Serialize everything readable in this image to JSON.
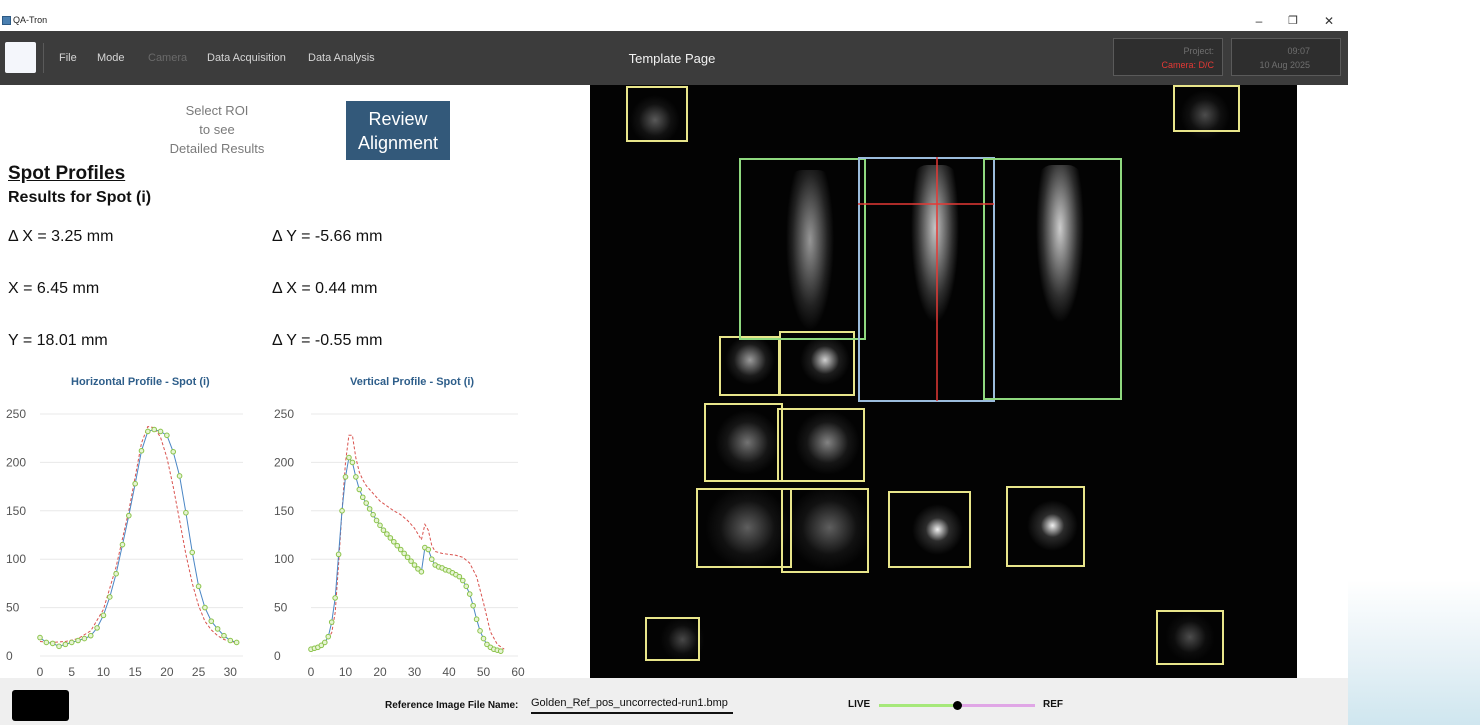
{
  "window": {
    "title": "QA-Tron",
    "minimize_symbol": "–",
    "restore_symbol": "❐",
    "close_symbol": "✕"
  },
  "header": {
    "menu": [
      "File",
      "Mode",
      "Camera",
      "Data Acquisition",
      "Data Analysis"
    ],
    "disabled_menu": [
      "Camera"
    ],
    "page_title": "Template Page",
    "project_label": "Project:",
    "camera_status": "Camera: D/C",
    "time": "09:07",
    "date": "10 Aug 2025"
  },
  "left_panel": {
    "select_roi_lines": [
      "Select ROI",
      "to see",
      "Detailed Results"
    ],
    "review_button_lines": [
      "Review",
      "Alignment"
    ],
    "section_title": "Spot Profiles",
    "section_subtitle": "Results for Spot (i)",
    "measurements": [
      "Δ X = 3.25 mm",
      "Δ Y = -5.66 mm",
      "X = 6.45 mm",
      "Δ X = 0.44 mm",
      "Y = 18.01 mm",
      "Δ Y = -0.55 mm"
    ]
  },
  "chart_data": [
    {
      "type": "line",
      "title": "Horizontal Profile - Spot (i)",
      "xlim": [
        0,
        32
      ],
      "ylim": [
        0,
        250
      ],
      "xticks": [
        0,
        5,
        10,
        15,
        20,
        25,
        30
      ],
      "yticks": [
        0,
        50,
        100,
        150,
        200,
        250
      ],
      "grid": true,
      "series": [
        {
          "style": "markers",
          "color": "#8bc34a",
          "x": [
            0,
            1,
            2,
            3,
            4,
            5,
            6,
            7,
            8,
            9,
            10,
            11,
            12,
            13,
            14,
            15,
            16,
            17,
            18,
            19,
            20,
            21,
            22,
            23,
            24,
            25,
            26,
            27,
            28,
            29,
            30,
            31
          ],
          "y": [
            19,
            14,
            13,
            10,
            12,
            14,
            16,
            18,
            21,
            29,
            42,
            61,
            85,
            115,
            145,
            178,
            212,
            232,
            234,
            232,
            228,
            211,
            186,
            148,
            107,
            72,
            50,
            36,
            28,
            21,
            16,
            14
          ]
        },
        {
          "style": "solid",
          "color": "#4a86c5",
          "x": [
            0,
            1,
            2,
            3,
            4,
            5,
            6,
            7,
            8,
            9,
            10,
            11,
            12,
            13,
            14,
            15,
            16,
            17,
            18,
            19,
            20,
            21,
            22,
            23,
            24,
            25,
            26,
            27,
            28,
            29,
            30,
            31
          ],
          "y": [
            19,
            14,
            13,
            10,
            12,
            14,
            16,
            18,
            21,
            29,
            42,
            61,
            85,
            115,
            145,
            178,
            212,
            232,
            234,
            232,
            228,
            211,
            186,
            148,
            107,
            72,
            50,
            36,
            28,
            21,
            16,
            14
          ]
        },
        {
          "style": "dashed",
          "color": "#d9534f",
          "x": [
            0,
            2,
            4,
            6,
            8,
            10,
            12,
            14,
            15,
            16,
            17,
            18,
            19,
            20,
            21,
            22,
            23,
            24,
            25,
            26,
            27,
            28,
            29,
            30,
            31
          ],
          "y": [
            15,
            14,
            15,
            18,
            26,
            48,
            92,
            150,
            185,
            220,
            237,
            236,
            226,
            205,
            175,
            140,
            105,
            75,
            52,
            36,
            27,
            21,
            17,
            15,
            14
          ]
        }
      ]
    },
    {
      "type": "line",
      "title": "Vertical Profile - Spot (i)",
      "xlim": [
        0,
        60
      ],
      "ylim": [
        0,
        250
      ],
      "xticks": [
        0,
        10,
        20,
        30,
        40,
        50,
        60
      ],
      "yticks": [
        0,
        50,
        100,
        150,
        200,
        250
      ],
      "grid": true,
      "series": [
        {
          "style": "markers",
          "color": "#8bc34a",
          "x": [
            0,
            1,
            2,
            3,
            4,
            5,
            6,
            7,
            8,
            9,
            10,
            11,
            12,
            13,
            14,
            15,
            16,
            17,
            18,
            19,
            20,
            21,
            22,
            23,
            24,
            25,
            26,
            27,
            28,
            29,
            30,
            31,
            32,
            33,
            34,
            35,
            36,
            37,
            38,
            39,
            40,
            41,
            42,
            43,
            44,
            45,
            46,
            47,
            48,
            49,
            50,
            51,
            52,
            53,
            54,
            55
          ],
          "y": [
            7,
            8,
            9,
            11,
            14,
            20,
            35,
            60,
            105,
            150,
            185,
            205,
            200,
            185,
            172,
            164,
            158,
            152,
            146,
            140,
            135,
            130,
            126,
            122,
            118,
            114,
            110,
            106,
            102,
            98,
            94,
            90,
            87,
            112,
            110,
            100,
            94,
            92,
            91,
            89,
            88,
            86,
            84,
            82,
            78,
            72,
            64,
            52,
            38,
            26,
            18,
            12,
            9,
            7,
            6,
            5
          ]
        },
        {
          "style": "solid",
          "color": "#4a86c5",
          "x": [
            0,
            1,
            2,
            3,
            4,
            5,
            6,
            7,
            8,
            9,
            10,
            11,
            12,
            13,
            14,
            15,
            16,
            17,
            18,
            19,
            20,
            21,
            22,
            23,
            24,
            25,
            26,
            27,
            28,
            29,
            30,
            31,
            32,
            33,
            34,
            35,
            36,
            37,
            38,
            39,
            40,
            41,
            42,
            43,
            44,
            45,
            46,
            47,
            48,
            49,
            50,
            51,
            52,
            53,
            54,
            55
          ],
          "y": [
            7,
            8,
            9,
            11,
            14,
            20,
            35,
            60,
            105,
            150,
            185,
            205,
            200,
            185,
            172,
            164,
            158,
            152,
            146,
            140,
            135,
            130,
            126,
            122,
            118,
            114,
            110,
            106,
            102,
            98,
            94,
            90,
            87,
            112,
            110,
            100,
            94,
            92,
            91,
            89,
            88,
            86,
            84,
            82,
            78,
            72,
            64,
            52,
            38,
            26,
            18,
            12,
            9,
            7,
            6,
            5
          ]
        },
        {
          "style": "dashed",
          "color": "#d9534f",
          "x": [
            0,
            2,
            4,
            6,
            7,
            8,
            9,
            10,
            11,
            12,
            13,
            14,
            15,
            16,
            18,
            20,
            22,
            24,
            26,
            28,
            30,
            32,
            33,
            34,
            35,
            36,
            38,
            40,
            42,
            44,
            46,
            48,
            50,
            52,
            54,
            56
          ],
          "y": [
            8,
            10,
            14,
            24,
            45,
            95,
            150,
            200,
            228,
            228,
            205,
            190,
            182,
            176,
            168,
            160,
            155,
            150,
            146,
            140,
            132,
            120,
            136,
            130,
            114,
            108,
            106,
            105,
            104,
            102,
            96,
            82,
            55,
            25,
            12,
            7
          ]
        }
      ]
    }
  ],
  "bottom_bar": {
    "ref_label": "Reference Image File Name:",
    "ref_file": "Golden_Ref_pos_uncorrected-run1.bmp",
    "live_label": "LIVE",
    "ref_tag": "REF",
    "blend_position": 0.5
  },
  "colors": {
    "header_bg": "#3c3c3c",
    "review_button": "#33597a",
    "roi_yellow": "#e8e58a",
    "roi_green": "#8fd97f",
    "roi_blue": "#9bbcdc",
    "crosshair_red": "#e53935",
    "camera_status_red": "#e53935"
  }
}
